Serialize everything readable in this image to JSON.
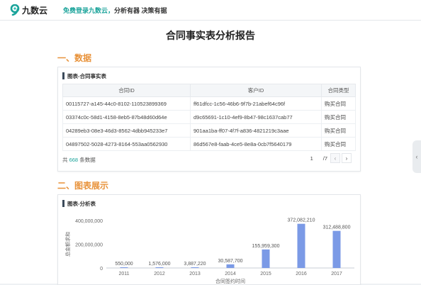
{
  "app": {
    "brand_name": "九数云",
    "slogan_highlight": "免费登录九数云，",
    "slogan_plain": "分析有器 决策有据"
  },
  "report": {
    "title": "合同事实表分析报告"
  },
  "sections": {
    "data": {
      "title": "一、数据"
    },
    "chart": {
      "title": "二、图表展示"
    }
  },
  "table_card": {
    "title": "图表-合同事实表",
    "columns": [
      "合同ID",
      "客户ID",
      "合同类型"
    ],
    "rows": [
      [
        "00115727-a145-44c0-8102-110523899369",
        "ff61dfcc-1c56-46b6-9f7b-21abef64c96f",
        "购买合同"
      ],
      [
        "03374c0c-58d1-4158-8eb5-87b48d60d64e",
        "d9c65691-1c10-4ef9-8b47-98c1637cab77",
        "购买合同"
      ],
      [
        "04289eb3-08e3-46d3-8562-4dbb945233e7",
        "901aa1ba-ff07-4f7f-a836-4821219c3aae",
        "购买合同"
      ],
      [
        "04897502-5028-4273-8164-553aa0562930",
        "86d567e8-faab-4ce5-8e8a-0cb7f5640179",
        "购买合同"
      ]
    ],
    "footer_prefix": "共",
    "footer_count": "668",
    "footer_suffix": "条数据",
    "page_current": "1",
    "page_total": "/7",
    "prev_icon": "‹",
    "next_icon": "›"
  },
  "chart_card": {
    "title": "图表-分析表"
  },
  "chart_data": {
    "type": "bar",
    "categories": [
      "2011",
      "2012",
      "2013",
      "2014",
      "2015",
      "2016",
      "2017"
    ],
    "values": [
      550000,
      1576000,
      3887220,
      30587700,
      155959300,
      372082210,
      312488800
    ],
    "value_labels": [
      "550,000",
      "1,576,000",
      "3,887,220",
      "30,587,700",
      "155,959,300",
      "372,082,210",
      "312,488,800"
    ],
    "ylim": [
      0,
      400000000
    ],
    "y_ticks": [
      0,
      200000000,
      400000000
    ],
    "y_tick_labels": [
      "0",
      "200,000,000",
      "400,000,000"
    ],
    "xlabel": "合同签约时间",
    "ylabel": "总金额求和",
    "bar_color": "#7b9ae6",
    "grid": false
  },
  "ui": {
    "side_handle_icon": "‹",
    "accent_color": "#1aa39a",
    "section_color": "#e8923a"
  }
}
